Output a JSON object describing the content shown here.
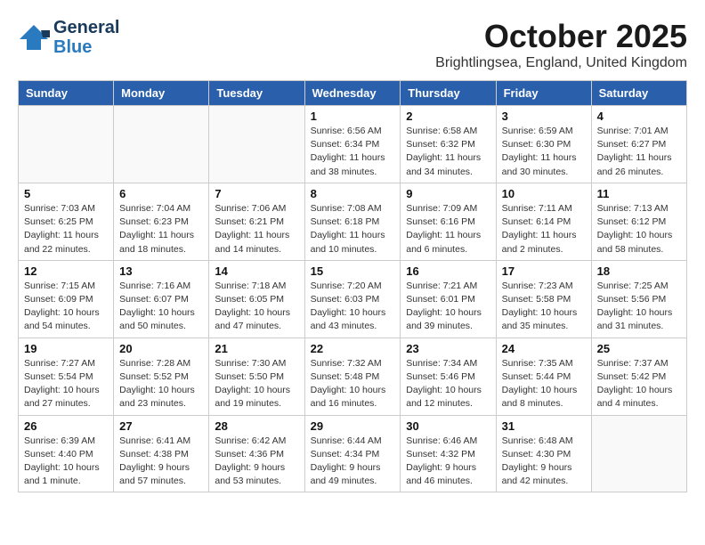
{
  "logo": {
    "line1": "General",
    "line2": "Blue"
  },
  "title": "October 2025",
  "location": "Brightlingsea, England, United Kingdom",
  "days_of_week": [
    "Sunday",
    "Monday",
    "Tuesday",
    "Wednesday",
    "Thursday",
    "Friday",
    "Saturday"
  ],
  "weeks": [
    [
      {
        "day": "",
        "info": ""
      },
      {
        "day": "",
        "info": ""
      },
      {
        "day": "",
        "info": ""
      },
      {
        "day": "1",
        "info": "Sunrise: 6:56 AM\nSunset: 6:34 PM\nDaylight: 11 hours\nand 38 minutes."
      },
      {
        "day": "2",
        "info": "Sunrise: 6:58 AM\nSunset: 6:32 PM\nDaylight: 11 hours\nand 34 minutes."
      },
      {
        "day": "3",
        "info": "Sunrise: 6:59 AM\nSunset: 6:30 PM\nDaylight: 11 hours\nand 30 minutes."
      },
      {
        "day": "4",
        "info": "Sunrise: 7:01 AM\nSunset: 6:27 PM\nDaylight: 11 hours\nand 26 minutes."
      }
    ],
    [
      {
        "day": "5",
        "info": "Sunrise: 7:03 AM\nSunset: 6:25 PM\nDaylight: 11 hours\nand 22 minutes."
      },
      {
        "day": "6",
        "info": "Sunrise: 7:04 AM\nSunset: 6:23 PM\nDaylight: 11 hours\nand 18 minutes."
      },
      {
        "day": "7",
        "info": "Sunrise: 7:06 AM\nSunset: 6:21 PM\nDaylight: 11 hours\nand 14 minutes."
      },
      {
        "day": "8",
        "info": "Sunrise: 7:08 AM\nSunset: 6:18 PM\nDaylight: 11 hours\nand 10 minutes."
      },
      {
        "day": "9",
        "info": "Sunrise: 7:09 AM\nSunset: 6:16 PM\nDaylight: 11 hours\nand 6 minutes."
      },
      {
        "day": "10",
        "info": "Sunrise: 7:11 AM\nSunset: 6:14 PM\nDaylight: 11 hours\nand 2 minutes."
      },
      {
        "day": "11",
        "info": "Sunrise: 7:13 AM\nSunset: 6:12 PM\nDaylight: 10 hours\nand 58 minutes."
      }
    ],
    [
      {
        "day": "12",
        "info": "Sunrise: 7:15 AM\nSunset: 6:09 PM\nDaylight: 10 hours\nand 54 minutes."
      },
      {
        "day": "13",
        "info": "Sunrise: 7:16 AM\nSunset: 6:07 PM\nDaylight: 10 hours\nand 50 minutes."
      },
      {
        "day": "14",
        "info": "Sunrise: 7:18 AM\nSunset: 6:05 PM\nDaylight: 10 hours\nand 47 minutes."
      },
      {
        "day": "15",
        "info": "Sunrise: 7:20 AM\nSunset: 6:03 PM\nDaylight: 10 hours\nand 43 minutes."
      },
      {
        "day": "16",
        "info": "Sunrise: 7:21 AM\nSunset: 6:01 PM\nDaylight: 10 hours\nand 39 minutes."
      },
      {
        "day": "17",
        "info": "Sunrise: 7:23 AM\nSunset: 5:58 PM\nDaylight: 10 hours\nand 35 minutes."
      },
      {
        "day": "18",
        "info": "Sunrise: 7:25 AM\nSunset: 5:56 PM\nDaylight: 10 hours\nand 31 minutes."
      }
    ],
    [
      {
        "day": "19",
        "info": "Sunrise: 7:27 AM\nSunset: 5:54 PM\nDaylight: 10 hours\nand 27 minutes."
      },
      {
        "day": "20",
        "info": "Sunrise: 7:28 AM\nSunset: 5:52 PM\nDaylight: 10 hours\nand 23 minutes."
      },
      {
        "day": "21",
        "info": "Sunrise: 7:30 AM\nSunset: 5:50 PM\nDaylight: 10 hours\nand 19 minutes."
      },
      {
        "day": "22",
        "info": "Sunrise: 7:32 AM\nSunset: 5:48 PM\nDaylight: 10 hours\nand 16 minutes."
      },
      {
        "day": "23",
        "info": "Sunrise: 7:34 AM\nSunset: 5:46 PM\nDaylight: 10 hours\nand 12 minutes."
      },
      {
        "day": "24",
        "info": "Sunrise: 7:35 AM\nSunset: 5:44 PM\nDaylight: 10 hours\nand 8 minutes."
      },
      {
        "day": "25",
        "info": "Sunrise: 7:37 AM\nSunset: 5:42 PM\nDaylight: 10 hours\nand 4 minutes."
      }
    ],
    [
      {
        "day": "26",
        "info": "Sunrise: 6:39 AM\nSunset: 4:40 PM\nDaylight: 10 hours\nand 1 minute."
      },
      {
        "day": "27",
        "info": "Sunrise: 6:41 AM\nSunset: 4:38 PM\nDaylight: 9 hours\nand 57 minutes."
      },
      {
        "day": "28",
        "info": "Sunrise: 6:42 AM\nSunset: 4:36 PM\nDaylight: 9 hours\nand 53 minutes."
      },
      {
        "day": "29",
        "info": "Sunrise: 6:44 AM\nSunset: 4:34 PM\nDaylight: 9 hours\nand 49 minutes."
      },
      {
        "day": "30",
        "info": "Sunrise: 6:46 AM\nSunset: 4:32 PM\nDaylight: 9 hours\nand 46 minutes."
      },
      {
        "day": "31",
        "info": "Sunrise: 6:48 AM\nSunset: 4:30 PM\nDaylight: 9 hours\nand 42 minutes."
      },
      {
        "day": "",
        "info": ""
      }
    ]
  ]
}
